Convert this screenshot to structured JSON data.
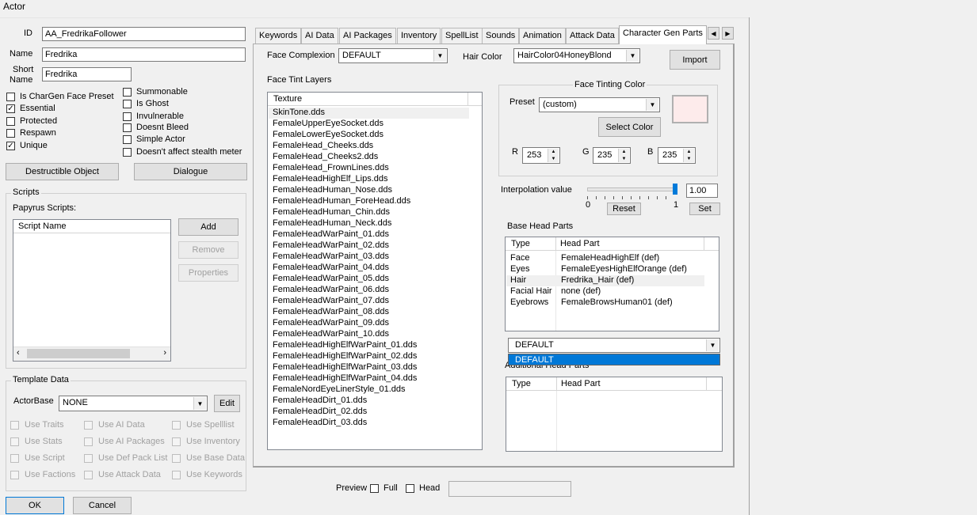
{
  "window": {
    "title": "Actor"
  },
  "left": {
    "id_label": "ID",
    "id_value": "AA_FredrikaFollower",
    "name_label": "Name",
    "name_value": "Fredrika",
    "short_label1": "Short",
    "short_label2": "Name",
    "short_value": "Fredrika",
    "checks_left": [
      {
        "label": "Is CharGen Face Preset",
        "checked": false
      },
      {
        "label": "Essential",
        "checked": true
      },
      {
        "label": "Protected",
        "checked": false
      },
      {
        "label": "Respawn",
        "checked": false
      },
      {
        "label": "Unique",
        "checked": true
      }
    ],
    "checks_right": [
      {
        "label": "Summonable",
        "checked": false
      },
      {
        "label": "Is Ghost",
        "checked": false
      },
      {
        "label": "Invulnerable",
        "checked": false
      },
      {
        "label": "Doesnt Bleed",
        "checked": false
      },
      {
        "label": "Simple Actor",
        "checked": false
      },
      {
        "label": "Doesn't affect stealth meter",
        "checked": false
      }
    ],
    "destructible_button": "Destructible Object",
    "dialogue_button": "Dialogue",
    "scripts_title": "Scripts",
    "papyrus_label": "Papyrus Scripts:",
    "script_col": "Script Name",
    "add_button": "Add",
    "remove_button": "Remove",
    "properties_button": "Properties",
    "template_title": "Template Data",
    "actorbase_label": "ActorBase",
    "actorbase_value": "NONE",
    "edit_button": "Edit",
    "template_checks": [
      [
        "Use Traits",
        "Use AI Data",
        "Use Spelllist"
      ],
      [
        "Use Stats",
        "Use AI Packages",
        "Use Inventory"
      ],
      [
        "Use Script",
        "Use Def Pack List",
        "Use Base Data"
      ],
      [
        "Use Factions",
        "Use Attack Data",
        "Use Keywords"
      ]
    ],
    "ok_button": "OK",
    "cancel_button": "Cancel"
  },
  "tabs": [
    "Keywords",
    "AI Data",
    "AI Packages",
    "Inventory",
    "SpellList",
    "Sounds",
    "Animation",
    "Attack Data",
    "Character Gen Parts"
  ],
  "active_tab": "Character Gen Parts",
  "chargen": {
    "face_complexion_label": "Face Complexion",
    "face_complexion_value": "DEFAULT",
    "hair_color_label": "Hair Color",
    "hair_color_value": "HairColor04HoneyBlond",
    "import_button": "Import",
    "tint_layers_label": "Face Tint Layers",
    "texture_col": "Texture",
    "textures": [
      "SkinTone.dds",
      "FemaleUpperEyeSocket.dds",
      "FemaleLowerEyeSocket.dds",
      "FemaleHead_Cheeks.dds",
      "FemaleHead_Cheeks2.dds",
      "FemaleHead_FrownLines.dds",
      "FemaleHeadHighElf_Lips.dds",
      "FemaleHeadHuman_Nose.dds",
      "FemaleHeadHuman_ForeHead.dds",
      "FemaleHeadHuman_Chin.dds",
      "FemaleHeadHuman_Neck.dds",
      "FemaleHeadWarPaint_01.dds",
      "FemaleHeadWarPaint_02.dds",
      "FemaleHeadWarPaint_03.dds",
      "FemaleHeadWarPaint_04.dds",
      "FemaleHeadWarPaint_05.dds",
      "FemaleHeadWarPaint_06.dds",
      "FemaleHeadWarPaint_07.dds",
      "FemaleHeadWarPaint_08.dds",
      "FemaleHeadWarPaint_09.dds",
      "FemaleHeadWarPaint_10.dds",
      "FemaleHeadHighElfWarPaint_01.dds",
      "FemaleHeadHighElfWarPaint_02.dds",
      "FemaleHeadHighElfWarPaint_03.dds",
      "FemaleHeadHighElfWarPaint_04.dds",
      "FemaleNordEyeLinerStyle_01.dds",
      "FemaleHeadDirt_01.dds",
      "FemaleHeadDirt_02.dds",
      "FemaleHeadDirt_03.dds"
    ],
    "tint_color_title": "Face Tinting Color",
    "preset_label": "Preset",
    "preset_value": "(custom)",
    "select_color_button": "Select Color",
    "swatch_color": "#fdebeb",
    "r_label": "R",
    "r_value": "253",
    "g_label": "G",
    "g_value": "235",
    "b_label": "B",
    "b_value": "235",
    "interp_label": "Interpolation value",
    "interp_value": "1.00",
    "slider_min": "0",
    "slider_max": "1",
    "slider_level": 1.0,
    "reset_button": "Reset",
    "set_button": "Set",
    "base_head_label": "Base Head Parts",
    "type_col": "Type",
    "headpart_col": "Head Part",
    "base_parts": [
      {
        "type": "Face",
        "part": "FemaleHeadHighElf (def)"
      },
      {
        "type": "Eyes",
        "part": "FemaleEyesHighElfOrange (def)"
      },
      {
        "type": "Hair",
        "part": "Fredrika_Hair (def)"
      },
      {
        "type": "Facial Hair",
        "part": "none (def)"
      },
      {
        "type": "Eyebrows",
        "part": "FemaleBrowsHuman01 (def)"
      }
    ],
    "default_combo_value": "DEFAULT",
    "default_option": "DEFAULT",
    "additional_label": "Additional Head Parts",
    "preview_label": "Preview",
    "full_label": "Full",
    "head_label": "Head"
  }
}
